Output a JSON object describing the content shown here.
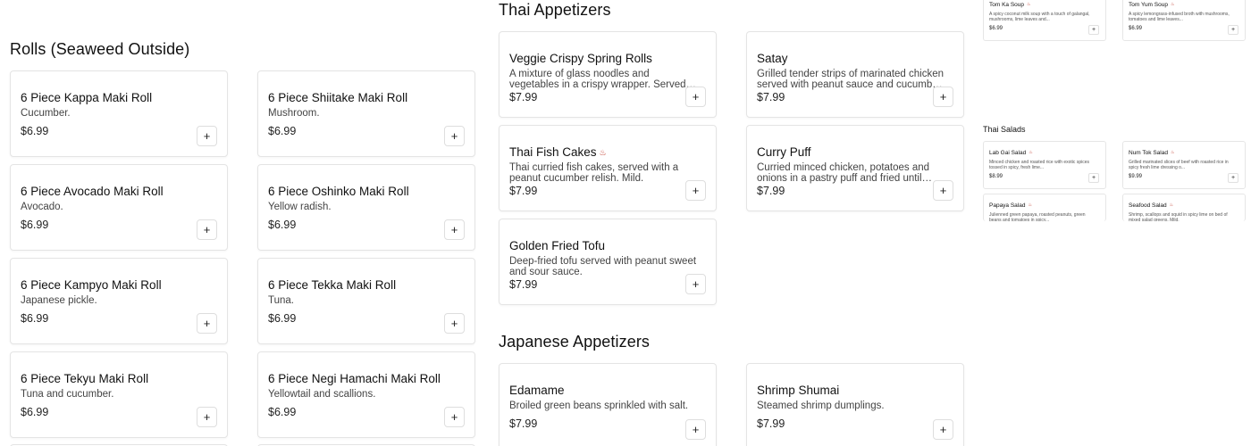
{
  "add_symbol": "+",
  "chili_glyph": "♨",
  "accent_chili": "#c0392b",
  "rolls": {
    "title": "Rolls (Seaweed Outside)",
    "items": [
      {
        "name": "6 Piece Kappa Maki Roll",
        "desc": "Cucumber.",
        "price": "$6.99"
      },
      {
        "name": "6 Piece Shiitake Maki Roll",
        "desc": "Mushroom.",
        "price": "$6.99"
      },
      {
        "name": "6 Piece Avocado Maki Roll",
        "desc": "Avocado.",
        "price": "$6.99"
      },
      {
        "name": "6 Piece Oshinko Maki Roll",
        "desc": "Yellow radish.",
        "price": "$6.99"
      },
      {
        "name": "6 Piece Kampyo Maki Roll",
        "desc": "Japanese pickle.",
        "price": "$6.99"
      },
      {
        "name": "6 Piece Tekka Maki Roll",
        "desc": "Tuna.",
        "price": "$6.99"
      },
      {
        "name": "6 Piece Tekyu Maki Roll",
        "desc": "Tuna and cucumber.",
        "price": "$6.99"
      },
      {
        "name": "6 Piece Negi Hamachi Maki Roll",
        "desc": "Yellowtail and scallions.",
        "price": "$6.99"
      }
    ]
  },
  "thai_appetizers": {
    "title": "Thai Appetizers",
    "items": [
      {
        "name": "Veggie Crispy Spring Rolls",
        "desc": "A mixture of glass noodles and vegetables in a crispy wrapper. Served with Thai sweet chili sauce.",
        "price": "$7.99"
      },
      {
        "name": "Satay",
        "desc": "Grilled tender strips of marinated chicken served with peanut sauce and cucumber relish.",
        "price": "$7.99"
      },
      {
        "name": "Thai Fish Cakes",
        "desc": "Thai curried fish cakes, served with a peanut cucumber relish. Mild.",
        "price": "$7.99",
        "spicy": true
      },
      {
        "name": "Curry Puff",
        "desc": "Curried minced chicken, potatoes and onions in a pastry puff and fried until golden.",
        "price": "$7.99"
      },
      {
        "name": "Golden Fried Tofu",
        "desc": "Deep-fried tofu served with peanut sweet and sour sauce.",
        "price": "$7.99"
      }
    ]
  },
  "japanese_appetizers": {
    "title": "Japanese Appetizers",
    "items": [
      {
        "name": "Edamame",
        "desc": "Broiled green beans sprinkled with salt.",
        "price": "$7.99"
      },
      {
        "name": "Shrimp Shumai",
        "desc": "Steamed shrimp dumplings.",
        "price": "$7.99"
      }
    ]
  },
  "soups": {
    "items": [
      {
        "name": "Tom Ka Soup",
        "desc": "A spicy coconut milk soup with a touch of galangal, mushrooms, lime leaves and...",
        "price": "$6.99"
      },
      {
        "name": "Tom Yum Soup",
        "desc": "A spicy lemongrass-infused broth with mushrooms, tomatoes and lime leaves...",
        "price": "$6.99"
      }
    ]
  },
  "thai_salads": {
    "title": "Thai Salads",
    "items": [
      {
        "name": "Lab Gai Salad",
        "desc": "Minced chicken and roasted rice with exotic spices tossed in spicy, fresh lime...",
        "price": "$8.99"
      },
      {
        "name": "Num Tok Salad",
        "desc": "Grilled marinated slices of beef with roasted rice in spicy fresh lime dressing o...",
        "price": "$9.99"
      },
      {
        "name": "Papaya Salad",
        "desc": "Julienned green papaya, roasted peanuts, green beans and tomatoes in spicy...",
        "price": ""
      },
      {
        "name": "Seafood Salad",
        "desc": "Shrimp, scallops and squid in spicy lime on bed of mixed salad greens. Mild.",
        "price": ""
      }
    ]
  }
}
